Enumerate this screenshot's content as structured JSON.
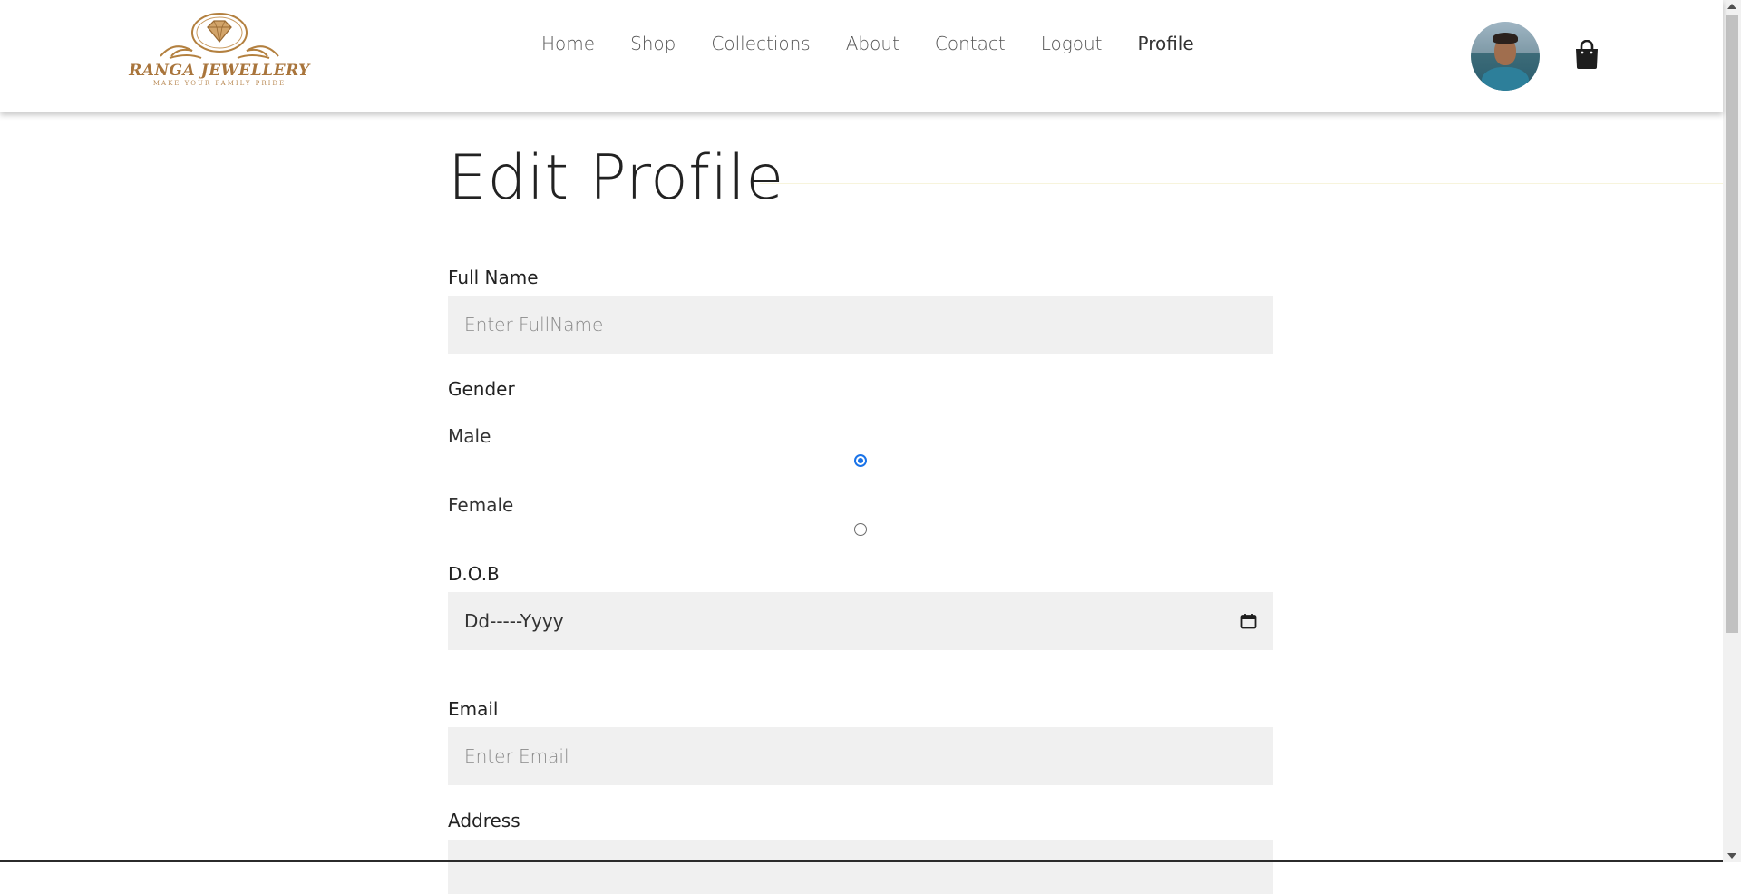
{
  "header": {
    "logo": {
      "brand": "RANGA JEWELLERY",
      "tagline": "MAKE YOUR FAMILY PRIDE"
    },
    "nav": [
      {
        "label": "Home"
      },
      {
        "label": "Shop"
      },
      {
        "label": "Collections"
      },
      {
        "label": "About"
      },
      {
        "label": "Contact"
      },
      {
        "label": "Logout"
      },
      {
        "label": "Profile",
        "active": true
      }
    ],
    "avatar_icon": "user-avatar",
    "cart_icon": "shopping-bag-icon"
  },
  "page": {
    "title": "Edit Profile"
  },
  "form": {
    "full_name": {
      "label": "Full Name",
      "placeholder": "Enter FullName",
      "value": ""
    },
    "gender": {
      "label": "Gender",
      "options": [
        {
          "label": "Male",
          "selected": true
        },
        {
          "label": "Female",
          "selected": false
        }
      ]
    },
    "dob": {
      "label": "D.O.B",
      "display": "Dd-----Yyyy",
      "icon": "calendar-icon"
    },
    "email": {
      "label": "Email",
      "placeholder": "Enter Email",
      "value": ""
    },
    "address": {
      "label": "Address"
    }
  },
  "colors": {
    "accent": "#1a73e8",
    "field_bg": "#f0f0f0",
    "logo_gold": "#a9753c"
  }
}
